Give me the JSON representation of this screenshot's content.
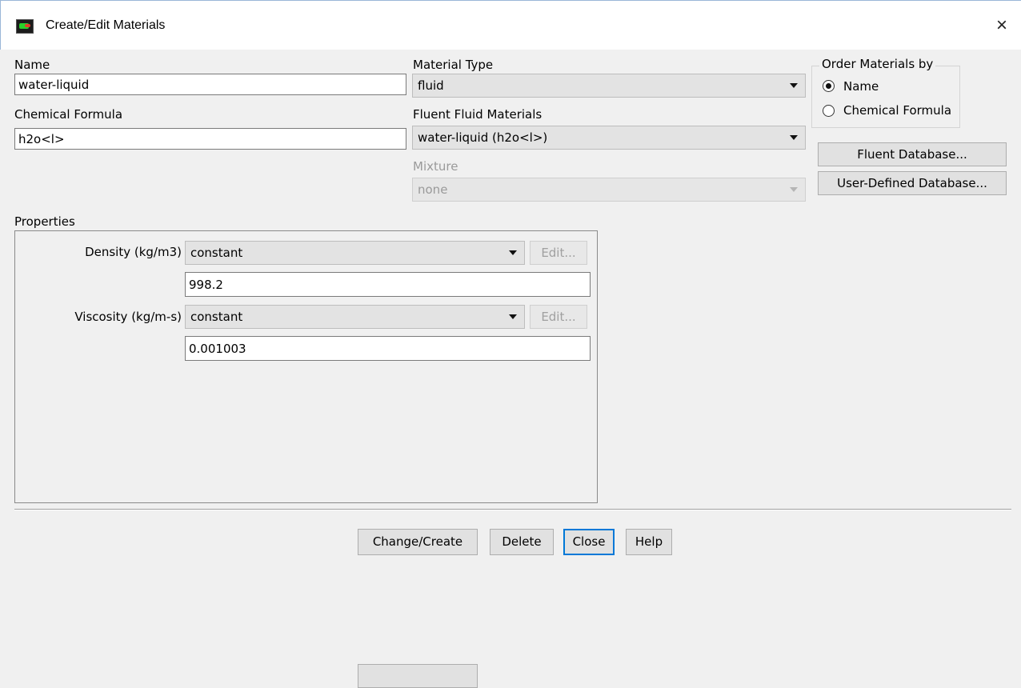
{
  "window": {
    "title": "Create/Edit Materials",
    "close_glyph": "×"
  },
  "name": {
    "label": "Name",
    "value": "water-liquid"
  },
  "chemical_formula": {
    "label": "Chemical Formula",
    "value": "h2o<l>"
  },
  "material_type": {
    "label": "Material Type",
    "value": "fluid"
  },
  "fluent_fluid_materials": {
    "label": "Fluent Fluid Materials",
    "value": "water-liquid (h2o<l>)"
  },
  "mixture": {
    "label": "Mixture",
    "value": "none"
  },
  "order_by": {
    "legend": "Order Materials by",
    "options": [
      {
        "label": "Name",
        "checked": true
      },
      {
        "label": "Chemical Formula",
        "checked": false
      }
    ]
  },
  "database_buttons": {
    "fluent": "Fluent Database...",
    "user_defined": "User-Defined Database..."
  },
  "properties": {
    "label": "Properties",
    "density": {
      "label": "Density (kg/m3)",
      "method": "constant",
      "edit": "Edit...",
      "value": "998.2"
    },
    "viscosity": {
      "label": "Viscosity (kg/m-s)",
      "method": "constant",
      "edit": "Edit...",
      "value": "0.001003"
    }
  },
  "actions": {
    "change_create": "Change/Create",
    "delete": "Delete",
    "close": "Close",
    "help": "Help"
  }
}
